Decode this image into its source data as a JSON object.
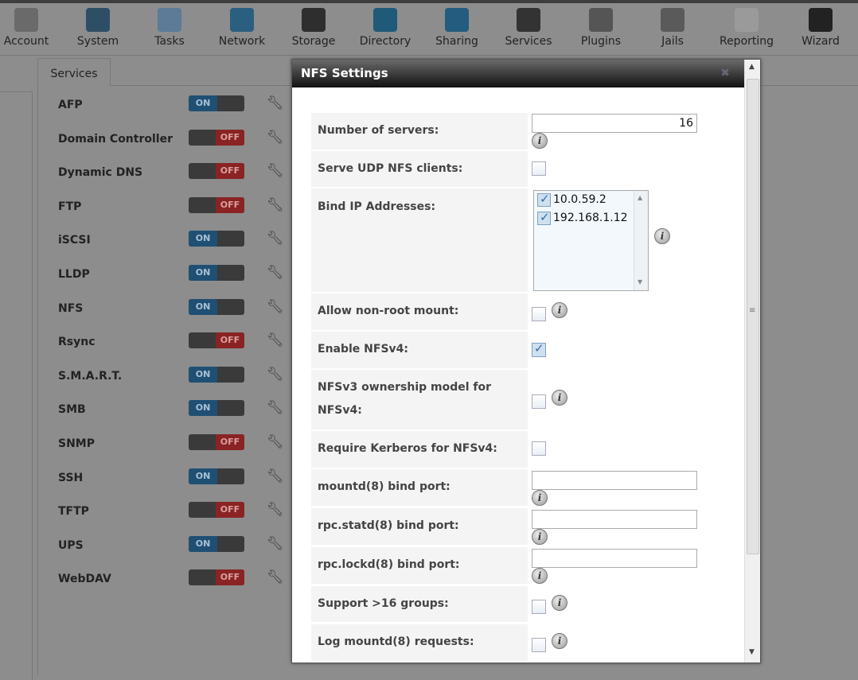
{
  "nav": [
    {
      "label": "Account",
      "icon": "account-icon",
      "color": "#6a6a6a"
    },
    {
      "label": "System",
      "icon": "system-icon",
      "color": "#2d4f66"
    },
    {
      "label": "Tasks",
      "icon": "tasks-icon",
      "color": "#5d7a96"
    },
    {
      "label": "Network",
      "icon": "network-icon",
      "color": "#2a5f7f"
    },
    {
      "label": "Storage",
      "icon": "storage-icon",
      "color": "#2e2e2e"
    },
    {
      "label": "Directory",
      "icon": "directory-icon",
      "color": "#1f5a78"
    },
    {
      "label": "Sharing",
      "icon": "sharing-icon",
      "color": "#235c7e"
    },
    {
      "label": "Services",
      "icon": "services-icon",
      "color": "#333333"
    },
    {
      "label": "Plugins",
      "icon": "plugins-icon",
      "color": "#555555"
    },
    {
      "label": "Jails",
      "icon": "jails-icon",
      "color": "#5a5a5a"
    },
    {
      "label": "Reporting",
      "icon": "reporting-icon",
      "color": "#9a9a9a"
    },
    {
      "label": "Wizard",
      "icon": "wizard-icon",
      "color": "#222222"
    }
  ],
  "tab": "Services",
  "toggle": {
    "on": "ON",
    "off": "OFF"
  },
  "services": [
    {
      "name": "AFP",
      "on": true
    },
    {
      "name": "Domain Controller",
      "on": false
    },
    {
      "name": "Dynamic DNS",
      "on": false
    },
    {
      "name": "FTP",
      "on": false
    },
    {
      "name": "iSCSI",
      "on": true
    },
    {
      "name": "LLDP",
      "on": true
    },
    {
      "name": "NFS",
      "on": true
    },
    {
      "name": "Rsync",
      "on": false
    },
    {
      "name": "S.M.A.R.T.",
      "on": true
    },
    {
      "name": "SMB",
      "on": true
    },
    {
      "name": "SNMP",
      "on": false
    },
    {
      "name": "SSH",
      "on": true
    },
    {
      "name": "TFTP",
      "on": false
    },
    {
      "name": "UPS",
      "on": true
    },
    {
      "name": "WebDAV",
      "on": false
    }
  ],
  "dialog": {
    "title": "NFS Settings",
    "number_of_servers": {
      "label": "Number of servers:",
      "value": "16"
    },
    "serve_udp": {
      "label": "Serve UDP NFS clients:",
      "checked": false
    },
    "bind_ip": {
      "label": "Bind IP Addresses:",
      "options": [
        {
          "ip": "10.0.59.2",
          "checked": true
        },
        {
          "ip": "192.168.1.12",
          "checked": true
        }
      ]
    },
    "allow_nonroot": {
      "label": "Allow non-root mount:",
      "checked": false
    },
    "enable_nfsv4": {
      "label": "Enable NFSv4:",
      "checked": true
    },
    "nfsv3_ownership": {
      "label": "NFSv3 ownership model for NFSv4:",
      "checked": false
    },
    "require_kerberos": {
      "label": "Require Kerberos for NFSv4:",
      "checked": false
    },
    "mountd_port": {
      "label": "mountd(8) bind port:",
      "value": ""
    },
    "statd_port": {
      "label": "rpc.statd(8) bind port:",
      "value": ""
    },
    "lockd_port": {
      "label": "rpc.lockd(8) bind port:",
      "value": ""
    },
    "support_16_groups": {
      "label": "Support >16 groups:",
      "checked": false
    },
    "log_mountd": {
      "label": "Log mountd(8) requests:",
      "checked": false
    }
  }
}
